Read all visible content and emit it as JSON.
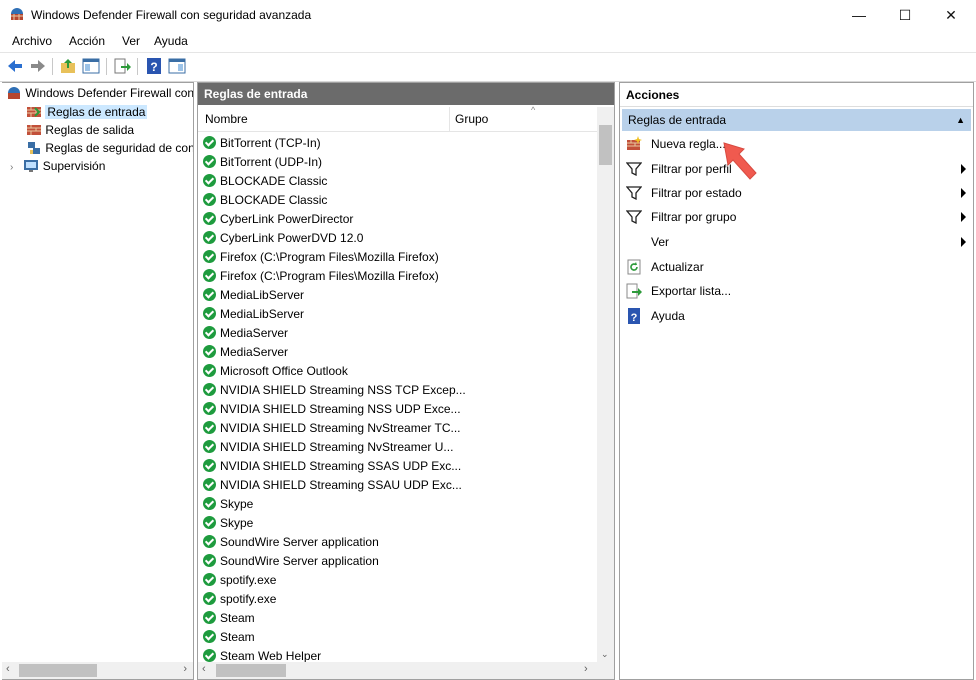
{
  "window": {
    "title": "Windows Defender Firewall con seguridad avanzada",
    "minimize": "—",
    "maximize": "☐",
    "close": "✕"
  },
  "menu": [
    "Archivo",
    "Acción",
    "Ver",
    "Ayuda"
  ],
  "tree": {
    "root": "Windows Defender Firewall con seguridad avanzada",
    "items": [
      "Reglas de entrada",
      "Reglas de salida",
      "Reglas de seguridad de conexión",
      "Supervisión"
    ]
  },
  "middle": {
    "title": "Reglas de entrada",
    "col_name": "Nombre",
    "col_group": "Grupo",
    "rows": [
      "BitTorrent (TCP-In)",
      "BitTorrent (UDP-In)",
      "BLOCKADE Classic",
      "BLOCKADE Classic",
      "CyberLink PowerDirector",
      "CyberLink PowerDVD 12.0",
      "Firefox (C:\\Program Files\\Mozilla Firefox)",
      "Firefox (C:\\Program Files\\Mozilla Firefox)",
      "MediaLibServer",
      "MediaLibServer",
      "MediaServer",
      "MediaServer",
      "Microsoft Office Outlook",
      "NVIDIA SHIELD Streaming NSS TCP Excep...",
      "NVIDIA SHIELD Streaming NSS UDP Exce...",
      "NVIDIA SHIELD Streaming NvStreamer TC...",
      "NVIDIA SHIELD Streaming NvStreamer U...",
      "NVIDIA SHIELD Streaming SSAS UDP Exc...",
      "NVIDIA SHIELD Streaming SSAU UDP Exc...",
      "Skype",
      "Skype",
      "SoundWire Server application",
      "SoundWire Server application",
      "spotify.exe",
      "spotify.exe",
      "Steam",
      "Steam",
      "Steam Web Helper"
    ]
  },
  "actions": {
    "title": "Acciones",
    "section": "Reglas de entrada",
    "items": [
      {
        "label": "Nueva regla...",
        "icon": "new-rule-icon",
        "submenu": false
      },
      {
        "label": "Filtrar por perfil",
        "icon": "filter-icon",
        "submenu": true
      },
      {
        "label": "Filtrar por estado",
        "icon": "filter-icon",
        "submenu": true
      },
      {
        "label": "Filtrar por grupo",
        "icon": "filter-icon",
        "submenu": true
      },
      {
        "label": "Ver",
        "icon": "",
        "submenu": true
      },
      {
        "label": "Actualizar",
        "icon": "refresh-icon",
        "submenu": false
      },
      {
        "label": "Exportar lista...",
        "icon": "export-icon",
        "submenu": false
      },
      {
        "label": "Ayuda",
        "icon": "help-icon",
        "submenu": false
      }
    ]
  },
  "colors": {
    "selection": "#cce8ff",
    "pane_header": "#6b6b6b",
    "actions_section": "#b9d1ea",
    "enabled_check": "#1e9b3e",
    "annotation_arrow": "#f05a4f"
  }
}
